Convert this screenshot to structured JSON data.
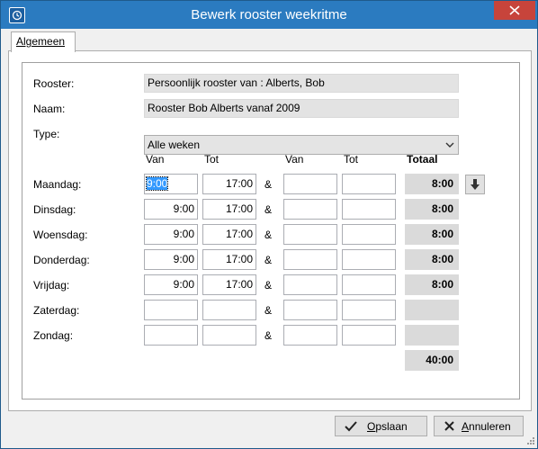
{
  "window": {
    "title": "Bewerk rooster weekritme"
  },
  "tabs": [
    {
      "label": "Algemeen",
      "underline": "A"
    }
  ],
  "form": {
    "rooster_label": "Rooster:",
    "rooster_value": "Persoonlijk rooster van : Alberts, Bob",
    "naam_label": "Naam:",
    "naam_value": "Rooster Bob Alberts vanaf 2009",
    "type_label": "Type:",
    "type_value": "Alle weken"
  },
  "schedule": {
    "headers": {
      "van1": "Van",
      "tot1": "Tot",
      "van2": "Van",
      "tot2": "Tot",
      "totaal": "Totaal"
    },
    "separator": "&",
    "days": [
      {
        "day": "Maandag:",
        "van1": "9:00",
        "tot1": "17:00",
        "van2": "",
        "tot2": "",
        "total": "8:00"
      },
      {
        "day": "Dinsdag:",
        "van1": "9:00",
        "tot1": "17:00",
        "van2": "",
        "tot2": "",
        "total": "8:00"
      },
      {
        "day": "Woensdag:",
        "van1": "9:00",
        "tot1": "17:00",
        "van2": "",
        "tot2": "",
        "total": "8:00"
      },
      {
        "day": "Donderdag:",
        "van1": "9:00",
        "tot1": "17:00",
        "van2": "",
        "tot2": "",
        "total": "8:00"
      },
      {
        "day": "Vrijdag:",
        "van1": "9:00",
        "tot1": "17:00",
        "van2": "",
        "tot2": "",
        "total": "8:00"
      },
      {
        "day": "Zaterdag:",
        "van1": "",
        "tot1": "",
        "van2": "",
        "tot2": "",
        "total": ""
      },
      {
        "day": "Zondag:",
        "van1": "",
        "tot1": "",
        "van2": "",
        "tot2": "",
        "total": ""
      }
    ],
    "grand_total": "40:00"
  },
  "buttons": {
    "save": {
      "pre": "",
      "u": "O",
      "post": "pslaan",
      "icon": "checkmark-icon"
    },
    "cancel": {
      "pre": "",
      "u": "A",
      "post": "nnuleren",
      "icon": "x-icon"
    }
  },
  "colors": {
    "titlebar": "#2b7bc0",
    "close": "#c7443b",
    "selection": "#3399ff"
  }
}
